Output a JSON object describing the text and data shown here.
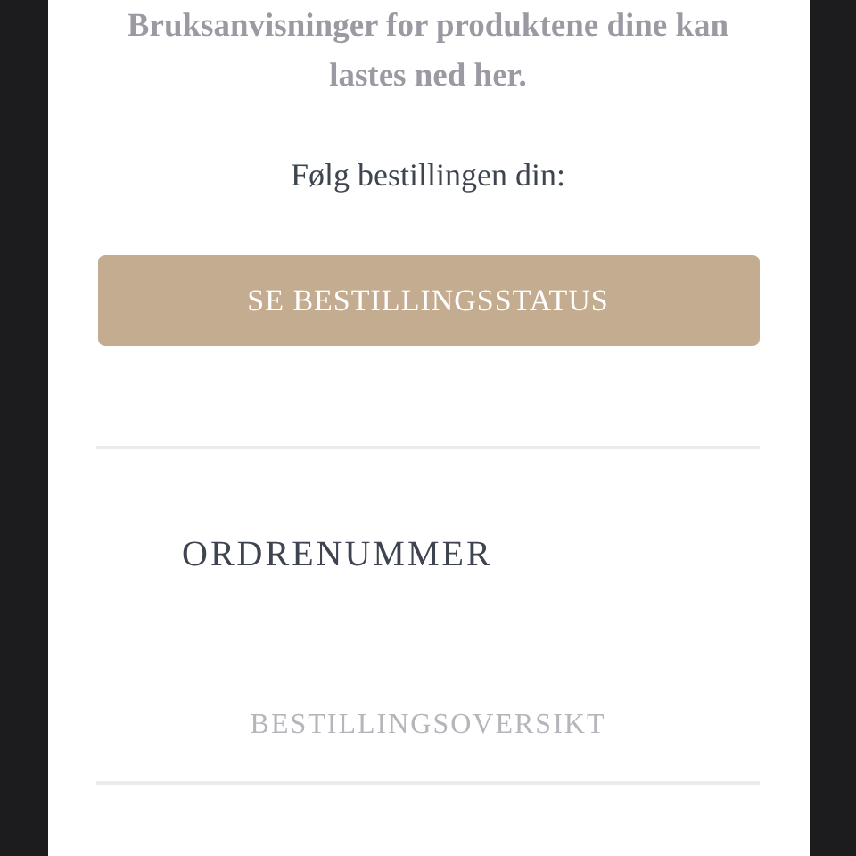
{
  "manuals_text": "Bruksanvisninger for produktene dine kan lastes ned her.",
  "tracking_label": "Følg bestillingen din:",
  "status_button": {
    "label": "SE BESTILLINGSSTATUS"
  },
  "order_number_label": "ORDRENUMMER",
  "order_overview_heading": "BESTILLINGSOVERSIKT"
}
